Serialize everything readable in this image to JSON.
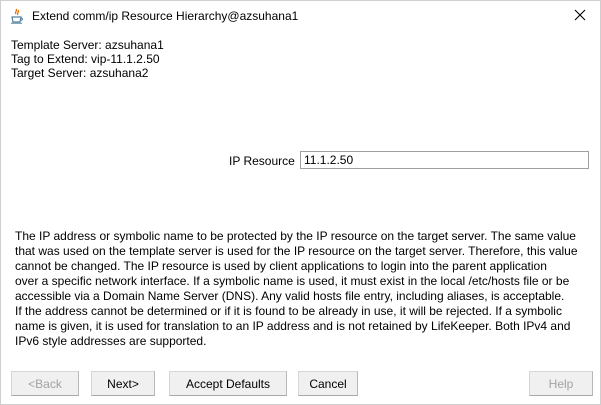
{
  "window": {
    "title": "Extend comm/ip Resource Hierarchy@azsuhana1",
    "app_icon": "java-icon",
    "close_icon": "close-icon"
  },
  "info": {
    "template_server": "Template Server: azsuhana1",
    "tag_to_extend": "Tag to Extend: vip-11.1.2.50",
    "target_server": "Target Server: azsuhana2"
  },
  "ip_resource": {
    "label": "IP Resource",
    "value": "11.1.2.50"
  },
  "help_text": {
    "lines": [
      "The IP address or symbolic name to be protected by the IP resource on the target server. The same value",
      "that was used on the template server is used for the IP resource on the target server. Therefore, this value",
      "cannot be changed. The IP resource is used by client applications to login into the parent application",
      "over a specific network interface. If a symbolic name is used, it must exist in the local /etc/hosts file or be",
      "accessible via a Domain Name Server (DNS). Any valid hosts file entry, including aliases, is acceptable.",
      "If the address cannot be determined or if it is found to be already in use, it will be rejected. If a symbolic",
      "name is given, it is used for translation to an IP address and is not retained by LifeKeeper. Both IPv4 and",
      "IPv6 style addresses are supported."
    ]
  },
  "buttons": {
    "back": "<Back",
    "next": "Next>",
    "accept_defaults": "Accept Defaults",
    "cancel": "Cancel",
    "help": "Help"
  },
  "colors": {
    "background": "#ffffff",
    "button_face": "#f0f0f0",
    "disabled_text": "#a3a3a3",
    "input_border": "#a0a0a0"
  }
}
